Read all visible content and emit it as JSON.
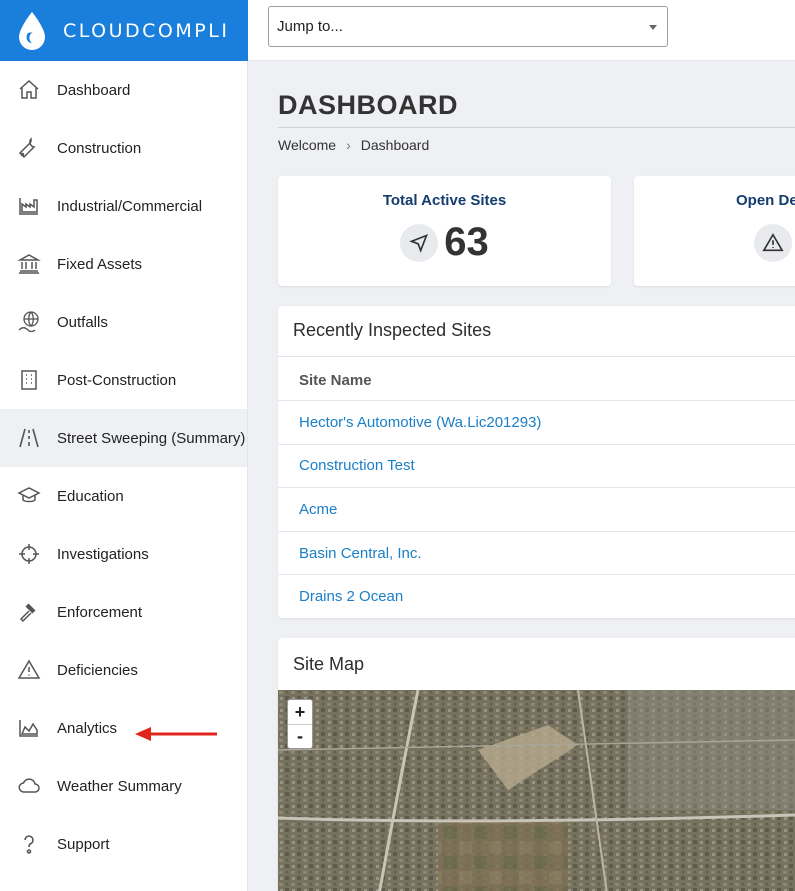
{
  "brand": {
    "name": "CLOUDCOMPLI",
    "color": "#1a7fdc"
  },
  "jump": {
    "placeholder": "Jump to..."
  },
  "sidebar": {
    "items": [
      {
        "label": "Dashboard",
        "icon": "home-icon"
      },
      {
        "label": "Construction",
        "icon": "wrench-icon"
      },
      {
        "label": "Industrial/Commercial",
        "icon": "factory-chart-icon"
      },
      {
        "label": "Fixed Assets",
        "icon": "bank-icon"
      },
      {
        "label": "Outfalls",
        "icon": "globe-pipe-icon"
      },
      {
        "label": "Post-Construction",
        "icon": "building-icon"
      },
      {
        "label": "Street Sweeping (Summary)",
        "icon": "road-icon",
        "active": true
      },
      {
        "label": "Education",
        "icon": "graduation-cap-icon"
      },
      {
        "label": "Investigations",
        "icon": "crosshair-icon"
      },
      {
        "label": "Enforcement",
        "icon": "gavel-icon"
      },
      {
        "label": "Deficiencies",
        "icon": "warning-icon"
      },
      {
        "label": "Analytics",
        "icon": "area-chart-icon"
      },
      {
        "label": "Weather Summary",
        "icon": "cloud-icon"
      },
      {
        "label": "Support",
        "icon": "question-icon"
      }
    ]
  },
  "page": {
    "title": "DASHBOARD",
    "breadcrumb": [
      "Welcome",
      "Dashboard"
    ]
  },
  "stats": [
    {
      "label": "Total Active Sites",
      "value": "63",
      "icon": "navigation-arrow-icon"
    },
    {
      "label": "Open De",
      "icon": "warning-icon"
    }
  ],
  "recent": {
    "title": "Recently Inspected Sites",
    "column": "Site Name",
    "rows": [
      "Hector's Automotive (Wa.Lic201293)",
      "Construction Test",
      "Acme",
      "Basin Central, Inc.",
      "Drains 2 Ocean"
    ]
  },
  "map": {
    "title": "Site Map",
    "zoom_in": "+",
    "zoom_out": "-"
  },
  "colors": {
    "link": "#1a7fc7",
    "stat_label": "#143c6e",
    "annotation_arrow": "#e0251b"
  }
}
